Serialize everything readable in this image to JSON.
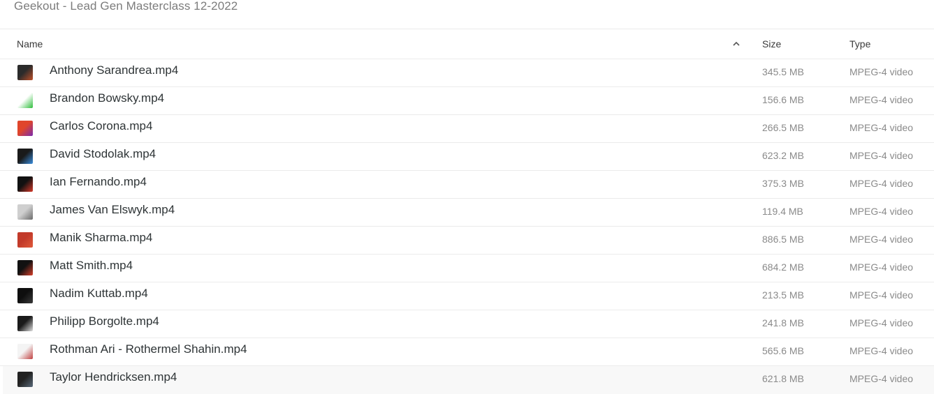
{
  "window": {
    "title": "Geekout - Lead Gen Masterclass 12-2022"
  },
  "header": {
    "name_label": "Name",
    "size_label": "Size",
    "type_label": "Type",
    "sort_icon": "chevron-up-icon"
  },
  "files": [
    {
      "name": "Anthony Sarandrea.mp4",
      "size": "345.5 MB",
      "type": "MPEG-4 video",
      "thumb_colors": [
        "#2b2b2b",
        "#c0512a"
      ]
    },
    {
      "name": "Brandon Bowsky.mp4",
      "size": "156.6 MB",
      "type": "MPEG-4 video",
      "thumb_colors": [
        "#ffffff",
        "#2dbd3a"
      ]
    },
    {
      "name": "Carlos Corona.mp4",
      "size": "266.5 MB",
      "type": "MPEG-4 video",
      "thumb_colors": [
        "#e0452b",
        "#7a2bb0"
      ]
    },
    {
      "name": "David Stodolak.mp4",
      "size": "623.2 MB",
      "type": "MPEG-4 video",
      "thumb_colors": [
        "#1a1a1a",
        "#3a8fe0"
      ]
    },
    {
      "name": "Ian Fernando.mp4",
      "size": "375.3 MB",
      "type": "MPEG-4 video",
      "thumb_colors": [
        "#111111",
        "#d83a2a"
      ]
    },
    {
      "name": "James Van Elswyk.mp4",
      "size": "119.4 MB",
      "type": "MPEG-4 video",
      "thumb_colors": [
        "#cfcfcf",
        "#6b6b6b"
      ]
    },
    {
      "name": "Manik Sharma.mp4",
      "size": "886.5 MB",
      "type": "MPEG-4 video",
      "thumb_colors": [
        "#c23a2a",
        "#e05a3a"
      ]
    },
    {
      "name": "Matt Smith.mp4",
      "size": "684.2 MB",
      "type": "MPEG-4 video",
      "thumb_colors": [
        "#111111",
        "#d8402a"
      ]
    },
    {
      "name": "Nadim Kuttab.mp4",
      "size": "213.5 MB",
      "type": "MPEG-4 video",
      "thumb_colors": [
        "#0e0e0e",
        "#3a3a3a"
      ]
    },
    {
      "name": "Philipp Borgolte.mp4",
      "size": "241.8 MB",
      "type": "MPEG-4 video",
      "thumb_colors": [
        "#1a1a1a",
        "#e0e0e0"
      ]
    },
    {
      "name": "Rothman Ari - Rothermel Shahin.mp4",
      "size": "565.6 MB",
      "type": "MPEG-4 video",
      "thumb_colors": [
        "#f4f4f4",
        "#c04040"
      ]
    },
    {
      "name": "Taylor Hendricksen.mp4",
      "size": "621.8 MB",
      "type": "MPEG-4 video",
      "thumb_colors": [
        "#222222",
        "#5a6a7a"
      ]
    }
  ]
}
